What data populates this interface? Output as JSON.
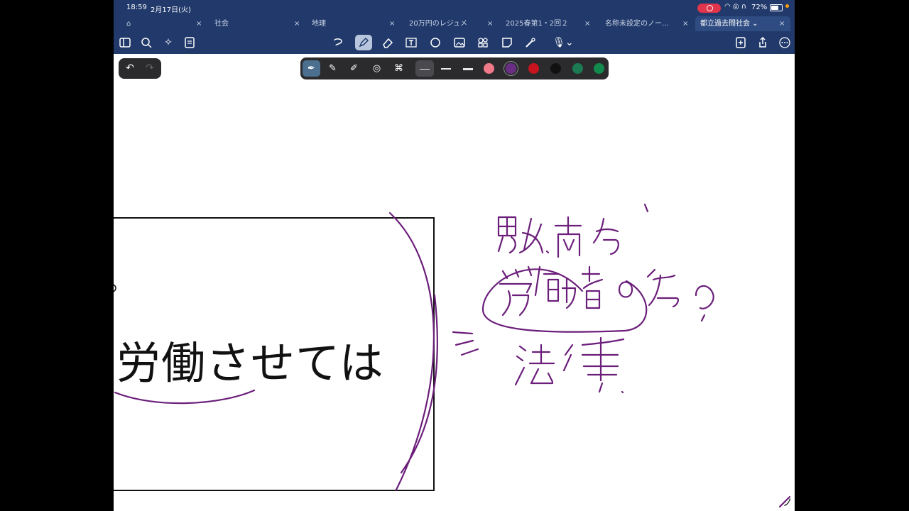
{
  "status": {
    "time": "18:59",
    "date": "2月17日(火)",
    "battery": "72%",
    "icons": [
      "wifi-icon",
      "location-icon",
      "headphones-icon"
    ]
  },
  "tabs": [
    {
      "label": "",
      "icon": "home-icon",
      "close": "×"
    },
    {
      "label": "社会",
      "close": "×"
    },
    {
      "label": "地理",
      "close": "×"
    },
    {
      "label": "20万円のレジュメ",
      "close": "×"
    },
    {
      "label": "2025春第1・2回２",
      "close": "×"
    },
    {
      "label": "名称未設定のノー…",
      "close": "×"
    },
    {
      "label": "都立過去問社会 ⌄",
      "close": "×",
      "active": true
    }
  ],
  "toolbar": {
    "left": [
      "sidebar-icon",
      "search-icon",
      "sparkle-icon",
      "document-icon"
    ],
    "center": [
      "lasso-icon",
      "pen-icon",
      "eraser-icon",
      "textbox-icon",
      "shapes-icon",
      "image-icon",
      "elements-icon",
      "sticky-note-icon",
      "laser-pointer-icon",
      "microphone-icon"
    ],
    "right": [
      "add-page-icon",
      "share-icon",
      "more-icon"
    ]
  },
  "undo": "↶",
  "redo": "↷",
  "palette": {
    "tools": [
      "fountain-pen",
      "ball-pen",
      "brush-pen",
      "shape-pen",
      "color-picker"
    ],
    "strokes": [
      1,
      2,
      3
    ],
    "colors": [
      "#F07A8A",
      "#6B2E85",
      "#C8141E",
      "#111111",
      "#1C7A52",
      "#138A4D"
    ],
    "selected_color": "#6B2E85"
  },
  "document": {
    "text": "労働させては",
    "handwriting": [
      "男女.両立",
      "労働者の為の",
      "⇒ 法律"
    ]
  },
  "scroll_hint": "ノ"
}
